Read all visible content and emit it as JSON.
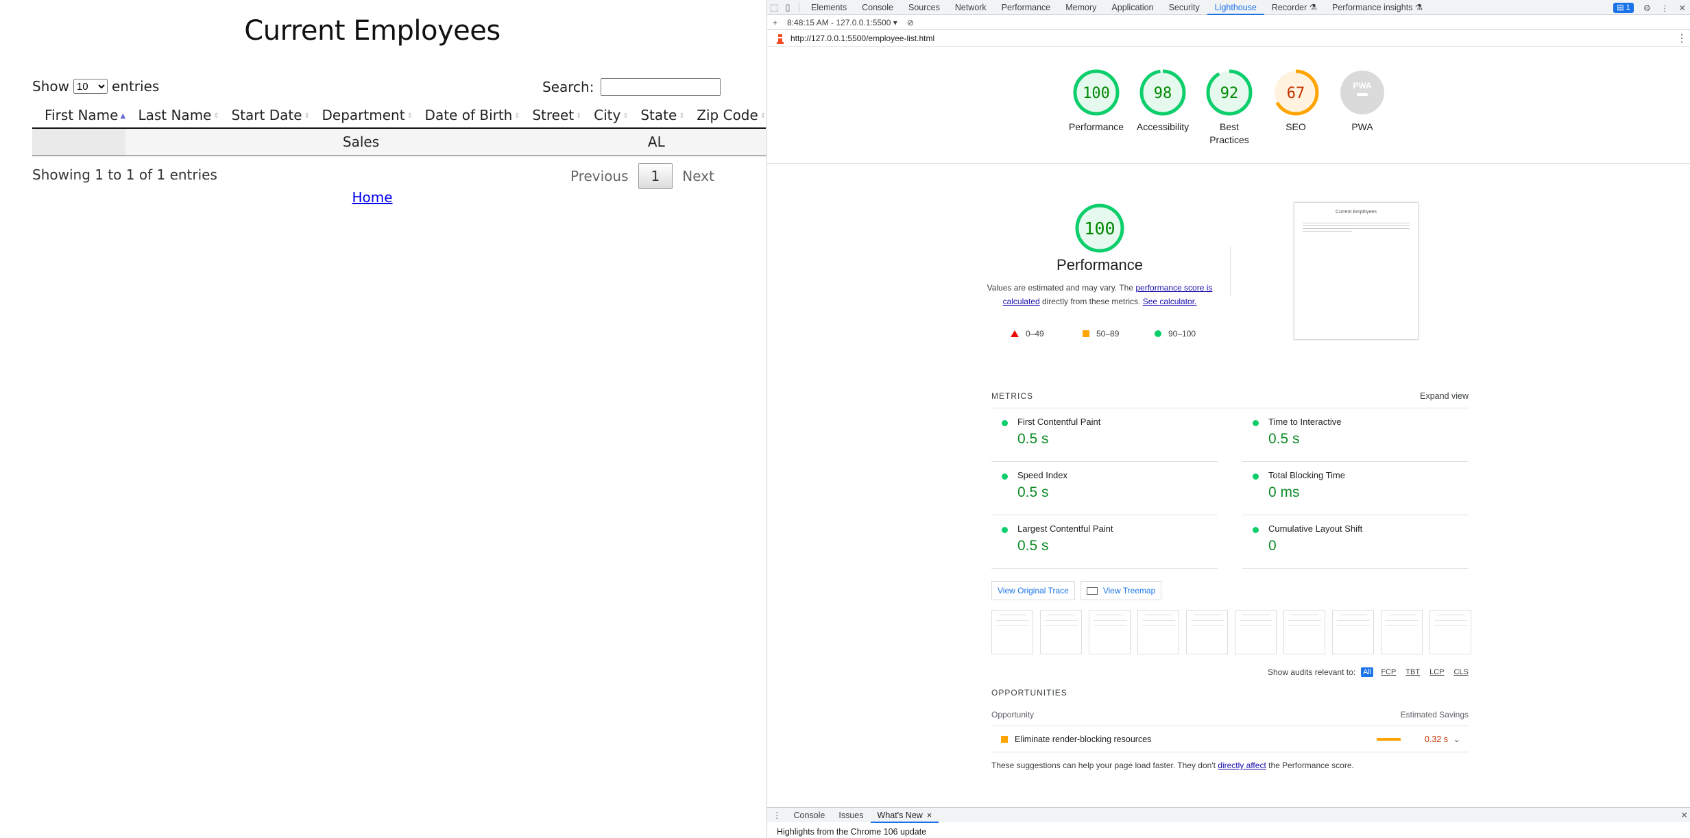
{
  "left": {
    "title": "Current Employees",
    "show_label": "Show",
    "entries_select": "10",
    "entries_label": "entries",
    "search_label": "Search:",
    "search_value": "",
    "columns": [
      "First Name",
      "Last Name",
      "Start Date",
      "Department",
      "Date of Birth",
      "Street",
      "City",
      "State",
      "Zip Code"
    ],
    "rows": [
      {
        "first": "",
        "last": "",
        "start": "",
        "department": "Sales",
        "dob": "",
        "street": "",
        "city": "",
        "state": "AL",
        "zip": ""
      }
    ],
    "info": "Showing 1 to 1 of 1 entries",
    "pager": {
      "previous": "Previous",
      "current": "1",
      "next": "Next"
    },
    "home_link": "Home"
  },
  "devtools": {
    "tabs": [
      "Elements",
      "Console",
      "Sources",
      "Network",
      "Performance",
      "Memory",
      "Application",
      "Security",
      "Lighthouse",
      "Recorder",
      "Performance insights"
    ],
    "active_tab": "Lighthouse",
    "badge_count": "1",
    "report_selector": "8:48:15 AM - 127.0.0.1:5500",
    "url": "http://127.0.0.1:5500/employee-list.html",
    "gauges": [
      {
        "score": "100",
        "label": "Performance",
        "color": "#0cce6b",
        "fraction": 1.0
      },
      {
        "score": "98",
        "label": "Accessibility",
        "color": "#0cce6b",
        "fraction": 0.98
      },
      {
        "score": "92",
        "label": "Best Practices",
        "color": "#0cce6b",
        "fraction": 0.92
      },
      {
        "score": "67",
        "label": "SEO",
        "color": "#ffa400",
        "fraction": 0.67
      },
      {
        "score": "PWA",
        "label": "PWA",
        "color": "#cccccc",
        "fraction": 0
      }
    ],
    "perf": {
      "score": "100",
      "title": "Performance",
      "desc_prefix": "Values are estimated and may vary. The ",
      "desc_link1": "performance score is calculated",
      "desc_mid": " directly from these metrics. ",
      "desc_link2": "See calculator.",
      "legend": [
        "0–49",
        "50–89",
        "90–100"
      ],
      "thumb_title": "Current Employees"
    },
    "metrics": {
      "heading": "METRICS",
      "expand": "Expand view",
      "items": [
        {
          "label": "First Contentful Paint",
          "value": "0.5 s"
        },
        {
          "label": "Time to Interactive",
          "value": "0.5 s"
        },
        {
          "label": "Speed Index",
          "value": "0.5 s"
        },
        {
          "label": "Total Blocking Time",
          "value": "0 ms"
        },
        {
          "label": "Largest Contentful Paint",
          "value": "0.5 s"
        },
        {
          "label": "Cumulative Layout Shift",
          "value": "0"
        }
      ]
    },
    "buttons": {
      "original_trace": "View Original Trace",
      "treemap": "View Treemap"
    },
    "audits_filter": {
      "label": "Show audits relevant to:",
      "chips": [
        "All",
        "FCP",
        "TBT",
        "LCP",
        "CLS"
      ]
    },
    "opportunities": {
      "heading": "OPPORTUNITIES",
      "col_left": "Opportunity",
      "col_right": "Estimated Savings",
      "items": [
        {
          "title": "Eliminate render-blocking resources",
          "saving": "0.32 s"
        }
      ],
      "note_prefix": "These suggestions can help your page load faster. They don't ",
      "note_link": "directly affect",
      "note_suffix": " the Performance score."
    },
    "drawer": {
      "tabs": [
        "Console",
        "Issues",
        "What's New"
      ],
      "active": "What's New",
      "content": "Highlights from the Chrome 106 update"
    }
  }
}
